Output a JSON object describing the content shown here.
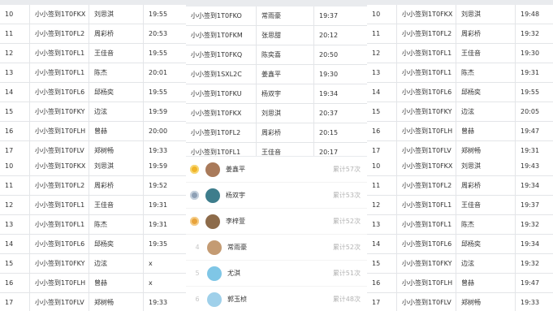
{
  "table_top_left": [
    [
      "10",
      "小小签到1T0FKX",
      "刘思淇",
      "19:55"
    ],
    [
      "11",
      "小小签到1T0FL2",
      "周彩桥",
      "20:53"
    ],
    [
      "12",
      "小小签到1T0FL1",
      "王佳音",
      "19:55"
    ],
    [
      "13",
      "小小签到1T0FL1",
      "陈杰",
      "20:01"
    ],
    [
      "14",
      "小小签到1T0FL6",
      "邱杨奕",
      "19:55"
    ],
    [
      "15",
      "小小签到1T0FKY",
      "边泫",
      "19:59"
    ],
    [
      "16",
      "小小签到1T0FLH",
      "曾赫",
      "20:00"
    ],
    [
      "17",
      "小小签到1T0FLV",
      "郑树畅",
      "19:33"
    ]
  ],
  "table_top_middle": [
    [
      "小小签到1T0FKO",
      "常雨豪",
      "19:37"
    ],
    [
      "小小签到1T0FKM",
      "张思甜",
      "20:12"
    ],
    [
      "小小签到1T0FKQ",
      "陈奕喜",
      "20:50"
    ],
    [
      "小小签到1SXL2C",
      "姜鑫平",
      "19:30"
    ],
    [
      "小小签到1T0FKU",
      "杨双宇",
      "19:34"
    ],
    [
      "小小签到1T0FKX",
      "刘思淇",
      "20:37"
    ],
    [
      "小小签到1T0FL2",
      "周彩桥",
      "20:15"
    ],
    [
      "小小签到1T0FL1",
      "王佳音",
      "20:17"
    ]
  ],
  "table_top_right": [
    [
      "10",
      "小小签到1T0FKX",
      "刘思淇",
      "19:48"
    ],
    [
      "11",
      "小小签到1T0FL2",
      "周彩桥",
      "19:32"
    ],
    [
      "12",
      "小小签到1T0FL1",
      "王佳音",
      "19:30"
    ],
    [
      "13",
      "小小签到1T0FL1",
      "陈杰",
      "19:31"
    ],
    [
      "14",
      "小小签到1T0FL6",
      "邱杨奕",
      "19:55"
    ],
    [
      "15",
      "小小签到1T0FKY",
      "边泫",
      "20:05"
    ],
    [
      "16",
      "小小签到1T0FLH",
      "曾赫",
      "19:47"
    ],
    [
      "17",
      "小小签到1T0FLV",
      "郑树畅",
      "19:31"
    ]
  ],
  "table_bottom_left": [
    [
      "10",
      "小小签到1T0FKX",
      "刘思淇",
      "19:59"
    ],
    [
      "11",
      "小小签到1T0FL2",
      "周彩桥",
      "19:52"
    ],
    [
      "12",
      "小小签到1T0FL1",
      "王佳音",
      "19:31"
    ],
    [
      "13",
      "小小签到1T0FL1",
      "陈杰",
      "19:31"
    ],
    [
      "14",
      "小小签到1T0FL6",
      "邱杨奕",
      "19:35"
    ],
    [
      "15",
      "小小签到1T0FKY",
      "边泫",
      "x"
    ],
    [
      "16",
      "小小签到1T0FLH",
      "曾赫",
      "x"
    ],
    [
      "17",
      "小小签到1T0FLV",
      "郑树畅",
      "19:33"
    ]
  ],
  "table_bottom_right": [
    [
      "10",
      "小小签到1T0FKX",
      "刘思淇",
      "19:43"
    ],
    [
      "11",
      "小小签到1T0FL2",
      "周彩桥",
      "19:34"
    ],
    [
      "12",
      "小小签到1T0FL1",
      "王佳音",
      "19:37"
    ],
    [
      "13",
      "小小签到1T0FL1",
      "陈杰",
      "19:32"
    ],
    [
      "14",
      "小小签到1T0FL6",
      "邱杨奕",
      "19:34"
    ],
    [
      "15",
      "小小签到1T0FKY",
      "边泫",
      "19:32"
    ],
    [
      "16",
      "小小签到1T0FLH",
      "曾赫",
      "19:47"
    ],
    [
      "17",
      "小小签到1T0FLV",
      "郑树畅",
      "19:33"
    ]
  ],
  "ranking": [
    {
      "rank": "1",
      "name": "姜鑫平",
      "count": "累计57次",
      "medal": "gold",
      "avatar_color": "#a97a5a"
    },
    {
      "rank": "2",
      "name": "杨双宇",
      "count": "累计53次",
      "medal": "silver",
      "avatar_color": "#3d7d8c"
    },
    {
      "rank": "3",
      "name": "李梓萱",
      "count": "累计52次",
      "medal": "bronze",
      "avatar_color": "#8d6b4a"
    },
    {
      "rank": "4",
      "name": "常雨豪",
      "count": "累计52次",
      "medal": "",
      "avatar_color": "#c49b73"
    },
    {
      "rank": "5",
      "name": "尤淇",
      "count": "累计51次",
      "medal": "",
      "avatar_color": "#7fc6e6"
    },
    {
      "rank": "6",
      "name": "郭玉桢",
      "count": "累计48次",
      "medal": "",
      "avatar_color": "#9fd0ea"
    }
  ]
}
